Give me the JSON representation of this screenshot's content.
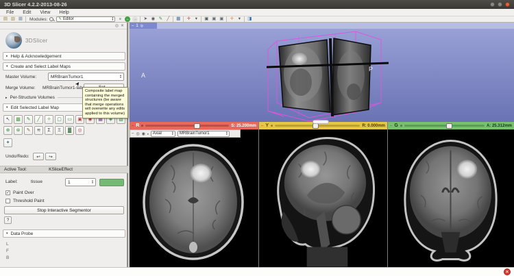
{
  "window": {
    "title": "3D Slicer 4.2.2-2013-08-26",
    "controls": [
      {
        "name": "minimize-button",
        "bg": "#8a8884"
      },
      {
        "name": "maximize-button",
        "bg": "#8a8884"
      },
      {
        "name": "close-button",
        "bg": "#e0613a"
      }
    ]
  },
  "menu": {
    "items": [
      "File",
      "Edit",
      "View",
      "Help"
    ]
  },
  "toolbar": {
    "modules_label": "Modules:",
    "module_selected": "Editor",
    "module_icon": "✎",
    "file_icons": [
      {
        "name": "load-data-icon",
        "glyph": "▤",
        "color": "#9c8a48"
      },
      {
        "name": "import-dicom-icon",
        "glyph": "▥",
        "color": "#9c8a48"
      },
      {
        "name": "save-icon",
        "glyph": "▦",
        "color": "#7d92a8"
      }
    ],
    "history_icons": [
      {
        "name": "module-history-icon",
        "glyph": "≡",
        "color": "#555555"
      },
      {
        "name": "module-back-icon",
        "glyph": "←",
        "color": "#ffffff",
        "bg": "#43a047"
      },
      {
        "name": "module-forward-icon",
        "glyph": "→",
        "color": "#888888",
        "bg": "#e2e0dd"
      }
    ],
    "action_icons": [
      {
        "name": "mouse-interaction-icon",
        "glyph": "➤",
        "color": "#5a5a66"
      },
      {
        "name": "viewers-icon",
        "glyph": "◉",
        "color": "#5a5a66"
      },
      {
        "name": "edit-pencil-icon",
        "glyph": "✎",
        "color": "#3d8b3d"
      },
      {
        "name": "ruler-icon",
        "glyph": "╱",
        "color": "#9c5a4a"
      },
      {
        "name": "separator"
      },
      {
        "name": "layout-icon",
        "glyph": "▦",
        "color": "#4a6fa5"
      },
      {
        "name": "separator"
      },
      {
        "name": "crosshair-icon",
        "glyph": "✛",
        "color": "#b03030"
      },
      {
        "name": "crosshair-dropdown-icon",
        "glyph": "▾",
        "color": "#555555"
      },
      {
        "name": "separator"
      },
      {
        "name": "screenshot-icon",
        "glyph": "▣",
        "color": "#556066"
      },
      {
        "name": "sceneview-capture-icon",
        "glyph": "▣",
        "color": "#667077"
      },
      {
        "name": "sceneview-restore-icon",
        "glyph": "▣",
        "color": "#667077"
      },
      {
        "name": "separator"
      },
      {
        "name": "annotation-add-icon",
        "glyph": "✛",
        "color": "#e07b1f"
      },
      {
        "name": "annotation-dropdown-icon",
        "glyph": "▾",
        "color": "#555555"
      },
      {
        "name": "separator"
      },
      {
        "name": "extensions-icon",
        "glyph": "◨",
        "color": "#2d6fb5"
      }
    ]
  },
  "ui": {
    "spin_up": "▴",
    "spin_down": "▾",
    "collapse": "–",
    "check": "✓",
    "eye": "◉",
    "pin": "◎",
    "close": "✕",
    "tri_open": "▾",
    "tri_closed": "▸"
  },
  "panel": {
    "logo_text": "3DSlicer",
    "help_section": "Help & Acknowledgement",
    "create_section": "Create and Select Label Maps",
    "master_volume_label": "Master Volume:",
    "master_volume_value": "MRBrainTumor1",
    "merge_volume_label": "Merge Volume:",
    "merge_volume_value": "MRBrainTumor1-label",
    "set_button_label": "Set...",
    "tooltip_text": "Composite label map containing the merged structures (be aware that merge operations will overwrite any edits applied to this volume)",
    "per_structure_section": "Per-Structure Volumes",
    "edit_section": "Edit Selected Label Map",
    "tools_row1": [
      {
        "name": "default-cursor-tool",
        "glyph": "↖",
        "color": "#3e4450"
      },
      {
        "name": "erase-label-tool",
        "glyph": "▩",
        "color": "#4a9c4a"
      },
      {
        "name": "paint-tool",
        "glyph": "✎",
        "color": "#2e8f2e"
      },
      {
        "name": "draw-tool",
        "glyph": "╱",
        "color": "#2e8f2e"
      },
      {
        "name": "wand-tool",
        "glyph": "✧",
        "color": "#2e8f2e"
      },
      {
        "name": "level-tracing-tool",
        "glyph": "▢",
        "color": "#2e8f2e"
      },
      {
        "name": "rectangle-tool",
        "glyph": "▭",
        "color": "#2e8f2e"
      },
      {
        "name": "identify-islands-tool",
        "glyph": "▣",
        "color": "#c04040"
      },
      {
        "name": "change-island-tool",
        "glyph": "◉",
        "color": "#c04040"
      },
      {
        "name": "remove-islands-tool",
        "glyph": "▦",
        "color": "#7a3f8f"
      },
      {
        "name": "save-island-tool",
        "glyph": "◈",
        "color": "#3f8f4a"
      },
      {
        "name": "change-label-tool",
        "glyph": "▧",
        "color": "#3f8f4a"
      }
    ],
    "tools_row2": [
      {
        "name": "dilate-tool",
        "glyph": "⊕",
        "color": "#2e8f2e"
      },
      {
        "name": "erode-tool",
        "glyph": "⊛",
        "color": "#2e8f2e"
      },
      {
        "name": "paint-over-tool",
        "glyph": "✎",
        "color": "#8f5a2e"
      },
      {
        "name": "fast-marching-tool",
        "glyph": "≋",
        "color": "#555555"
      },
      {
        "name": "threshold-tool",
        "glyph": "Σ",
        "color": "#444444"
      },
      {
        "name": "interpolate-tool",
        "glyph": "Ξ",
        "color": "#444444"
      },
      {
        "name": "mask-tool",
        "glyph": "▓",
        "color": "#3f6f3f"
      },
      {
        "name": "watershed-tool",
        "glyph": "◎",
        "color": "#c04040"
      }
    ],
    "tools_row3": [
      {
        "name": "kslice-tool",
        "glyph": "✦",
        "color": "#3f6f9f"
      }
    ],
    "undo_redo_label": "Undo/Redo:",
    "undo_icon": "↩",
    "redo_icon": "↪",
    "active_tool_label": "Active Tool:",
    "active_tool_value": "KSliceEffect",
    "label_caption": "Label:",
    "label_name": "tissue",
    "label_value": "1",
    "paint_over_label": "Paint Over",
    "threshold_paint_label": "Threshold Paint",
    "stop_button_label": "Stop Interactive Segmentor",
    "help_button_label": "?",
    "data_probe_section": "Data Probe",
    "probe_layers": [
      "L",
      "F",
      "B"
    ]
  },
  "views": {
    "view3d": {
      "view_label": "1",
      "orient_a": "A",
      "orient_p": "P"
    },
    "red": {
      "letter": "R",
      "offset": "S: 25.200mm",
      "orientation": "Axial",
      "volume": "MRBrainTumor1"
    },
    "yellow": {
      "letter": "Y",
      "offset": "R: 0.000mm"
    },
    "green": {
      "letter": "G",
      "offset": "A: 25.312mm"
    }
  },
  "colors": {
    "red_bar": "#e8685c",
    "yellow_bar": "#e2c845",
    "green_bar": "#76c06e",
    "threed_bg_top": "#9ba3d8",
    "threed_bg_bottom": "#6a73b4",
    "label_swatch": "#74ba74",
    "roi_wireframe": "#dd55dd",
    "tooltip_bg": "#ffffdc"
  }
}
